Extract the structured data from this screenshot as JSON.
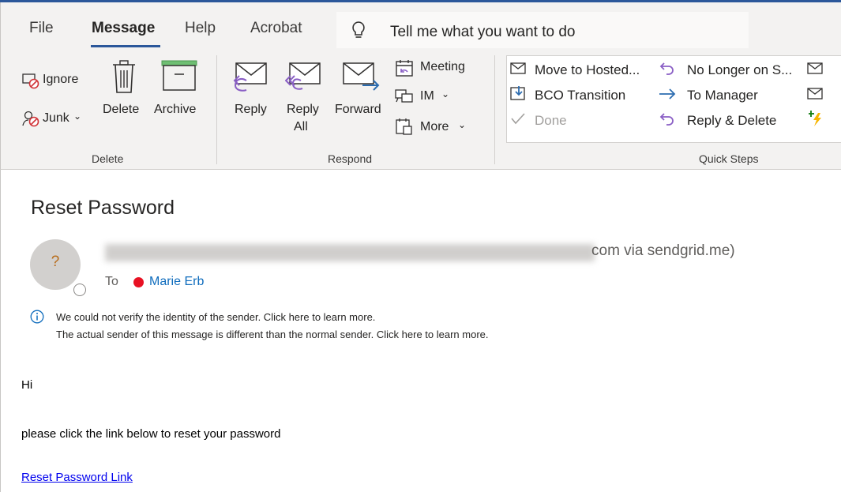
{
  "tabs": [
    "File",
    "Message",
    "Help",
    "Acrobat"
  ],
  "active_tab": "Message",
  "tell_me": "Tell me what you want to do",
  "ribbon": {
    "delete_group": {
      "label": "Delete",
      "ignore": "Ignore",
      "junk": "Junk",
      "delete": "Delete",
      "archive": "Archive"
    },
    "respond_group": {
      "label": "Respond",
      "reply": "Reply",
      "reply_all_line1": "Reply",
      "reply_all_line2": "All",
      "forward": "Forward",
      "meeting": "Meeting",
      "im": "IM",
      "more": "More"
    },
    "quick_steps": {
      "label": "Quick Steps",
      "items": [
        "Move to Hosted...",
        "No Longer on S...",
        "BCO Transition",
        "To Manager",
        "Done",
        "Reply & Delete"
      ]
    }
  },
  "message": {
    "subject": "Reset Password",
    "avatar_initial": "?",
    "sender_visible_tail": "com via sendgrid.me)",
    "to_label": "To",
    "recipient": "Marie Erb",
    "warning_line1": "We could not verify the identity of the sender. Click here to learn more.",
    "warning_line2": "The actual sender of this message is different than the normal sender. Click here to learn more.",
    "body_greeting": "Hi",
    "body_text": "please click the link below to reset your password",
    "link_text": "Reset Password Link"
  },
  "colors": {
    "accent": "#2b579a",
    "link": "#0000ee",
    "presence_busy": "#e81123",
    "icon_purple": "#8a5fc5",
    "icon_blue": "#2b6cb0"
  }
}
